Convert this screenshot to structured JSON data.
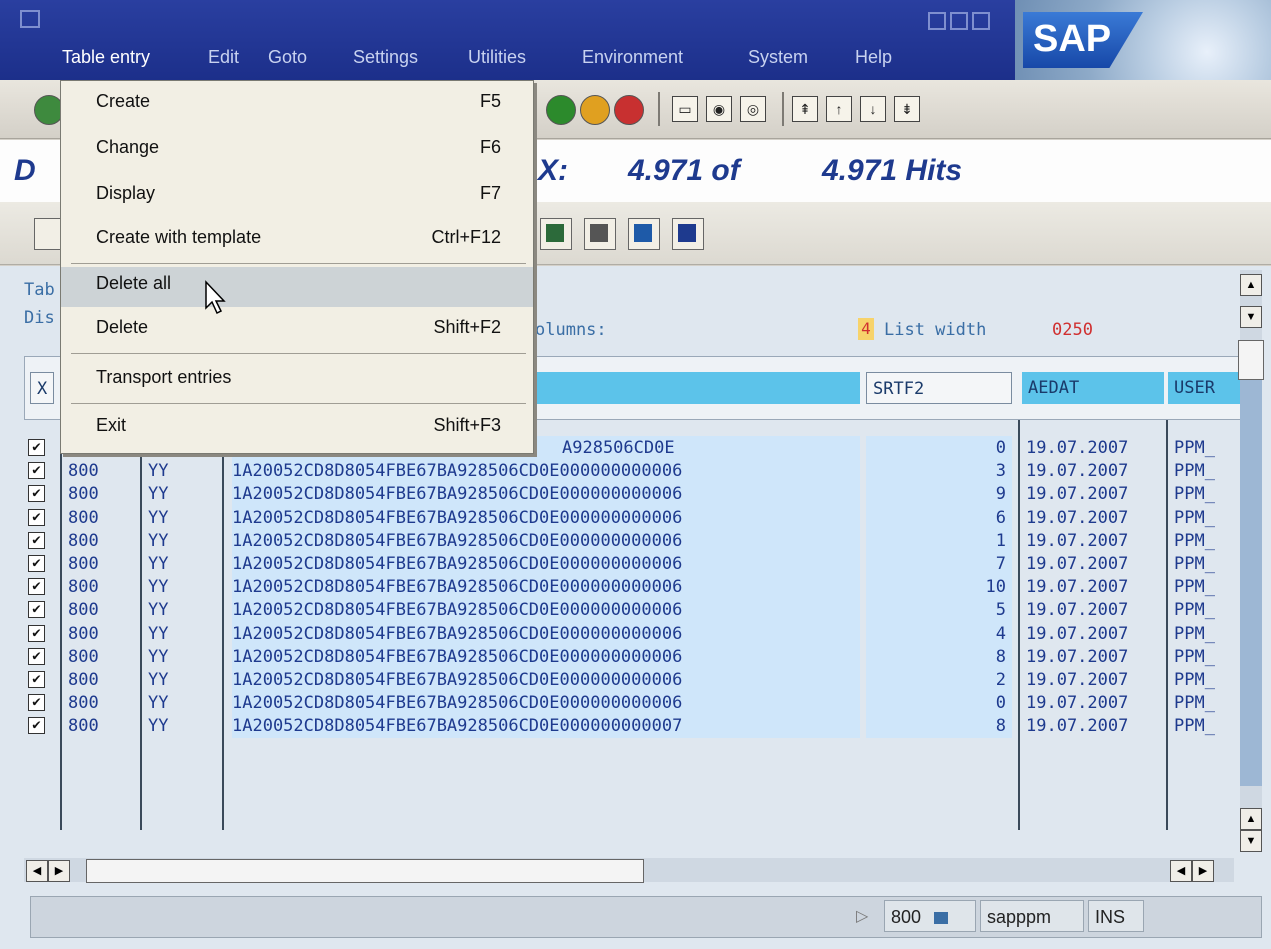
{
  "menubar": {
    "items": [
      "Table entry",
      "Edit",
      "Goto",
      "Settings",
      "Utilities",
      "Environment",
      "System",
      "Help"
    ],
    "logo": "SAP"
  },
  "title": {
    "prefix": "D",
    "x": "X:",
    "count": "4.971 of",
    "hits": "4.971 Hits"
  },
  "info": {
    "line1": "Tab",
    "line2": "Dis",
    "columns": "olumns:",
    "fixed_cols": "4",
    "list_width_label": "List width",
    "list_width": "0250"
  },
  "table": {
    "columns": [
      "X",
      "SRTF2",
      "AEDAT",
      "USER"
    ],
    "rows": [
      {
        "mandt": "",
        "typ": "",
        "key": "A928506CD0E",
        "srtf2": "0",
        "aedat": "19.07.2007",
        "user": "PPM_"
      },
      {
        "mandt": "800",
        "typ": "YY",
        "key": "1A20052CD8D8054FBE67BA928506CD0E000000000006",
        "srtf2": "3",
        "aedat": "19.07.2007",
        "user": "PPM_"
      },
      {
        "mandt": "800",
        "typ": "YY",
        "key": "1A20052CD8D8054FBE67BA928506CD0E000000000006",
        "srtf2": "9",
        "aedat": "19.07.2007",
        "user": "PPM_"
      },
      {
        "mandt": "800",
        "typ": "YY",
        "key": "1A20052CD8D8054FBE67BA928506CD0E000000000006",
        "srtf2": "6",
        "aedat": "19.07.2007",
        "user": "PPM_"
      },
      {
        "mandt": "800",
        "typ": "YY",
        "key": "1A20052CD8D8054FBE67BA928506CD0E000000000006",
        "srtf2": "1",
        "aedat": "19.07.2007",
        "user": "PPM_"
      },
      {
        "mandt": "800",
        "typ": "YY",
        "key": "1A20052CD8D8054FBE67BA928506CD0E000000000006",
        "srtf2": "7",
        "aedat": "19.07.2007",
        "user": "PPM_"
      },
      {
        "mandt": "800",
        "typ": "YY",
        "key": "1A20052CD8D8054FBE67BA928506CD0E000000000006",
        "srtf2": "10",
        "aedat": "19.07.2007",
        "user": "PPM_"
      },
      {
        "mandt": "800",
        "typ": "YY",
        "key": "1A20052CD8D8054FBE67BA928506CD0E000000000006",
        "srtf2": "5",
        "aedat": "19.07.2007",
        "user": "PPM_"
      },
      {
        "mandt": "800",
        "typ": "YY",
        "key": "1A20052CD8D8054FBE67BA928506CD0E000000000006",
        "srtf2": "4",
        "aedat": "19.07.2007",
        "user": "PPM_"
      },
      {
        "mandt": "800",
        "typ": "YY",
        "key": "1A20052CD8D8054FBE67BA928506CD0E000000000006",
        "srtf2": "8",
        "aedat": "19.07.2007",
        "user": "PPM_"
      },
      {
        "mandt": "800",
        "typ": "YY",
        "key": "1A20052CD8D8054FBE67BA928506CD0E000000000006",
        "srtf2": "2",
        "aedat": "19.07.2007",
        "user": "PPM_"
      },
      {
        "mandt": "800",
        "typ": "YY",
        "key": "1A20052CD8D8054FBE67BA928506CD0E000000000006",
        "srtf2": "0",
        "aedat": "19.07.2007",
        "user": "PPM_"
      },
      {
        "mandt": "800",
        "typ": "YY",
        "key": "1A20052CD8D8054FBE67BA928506CD0E000000000007",
        "srtf2": "8",
        "aedat": "19.07.2007",
        "user": "PPM_"
      }
    ]
  },
  "dropdown": {
    "items": [
      {
        "label": "Create",
        "shortcut": "F5"
      },
      {
        "label": "Change",
        "shortcut": "F6"
      },
      {
        "label": "Display",
        "shortcut": "F7"
      },
      {
        "label": "Create with template",
        "shortcut": "Ctrl+F12"
      },
      {
        "label": "Delete all",
        "shortcut": ""
      },
      {
        "label": "Delete",
        "shortcut": "Shift+F2"
      },
      {
        "label": "Transport entries",
        "shortcut": ""
      },
      {
        "label": "Exit",
        "shortcut": "Shift+F3"
      }
    ],
    "highlighted": "Delete all"
  },
  "statusbar": {
    "client": "800",
    "server": "sapppm",
    "mode": "INS"
  },
  "colors": {
    "menubar": "#1c2f8a",
    "title": "#1e3a8e",
    "highlight": "#cdd3d6"
  }
}
